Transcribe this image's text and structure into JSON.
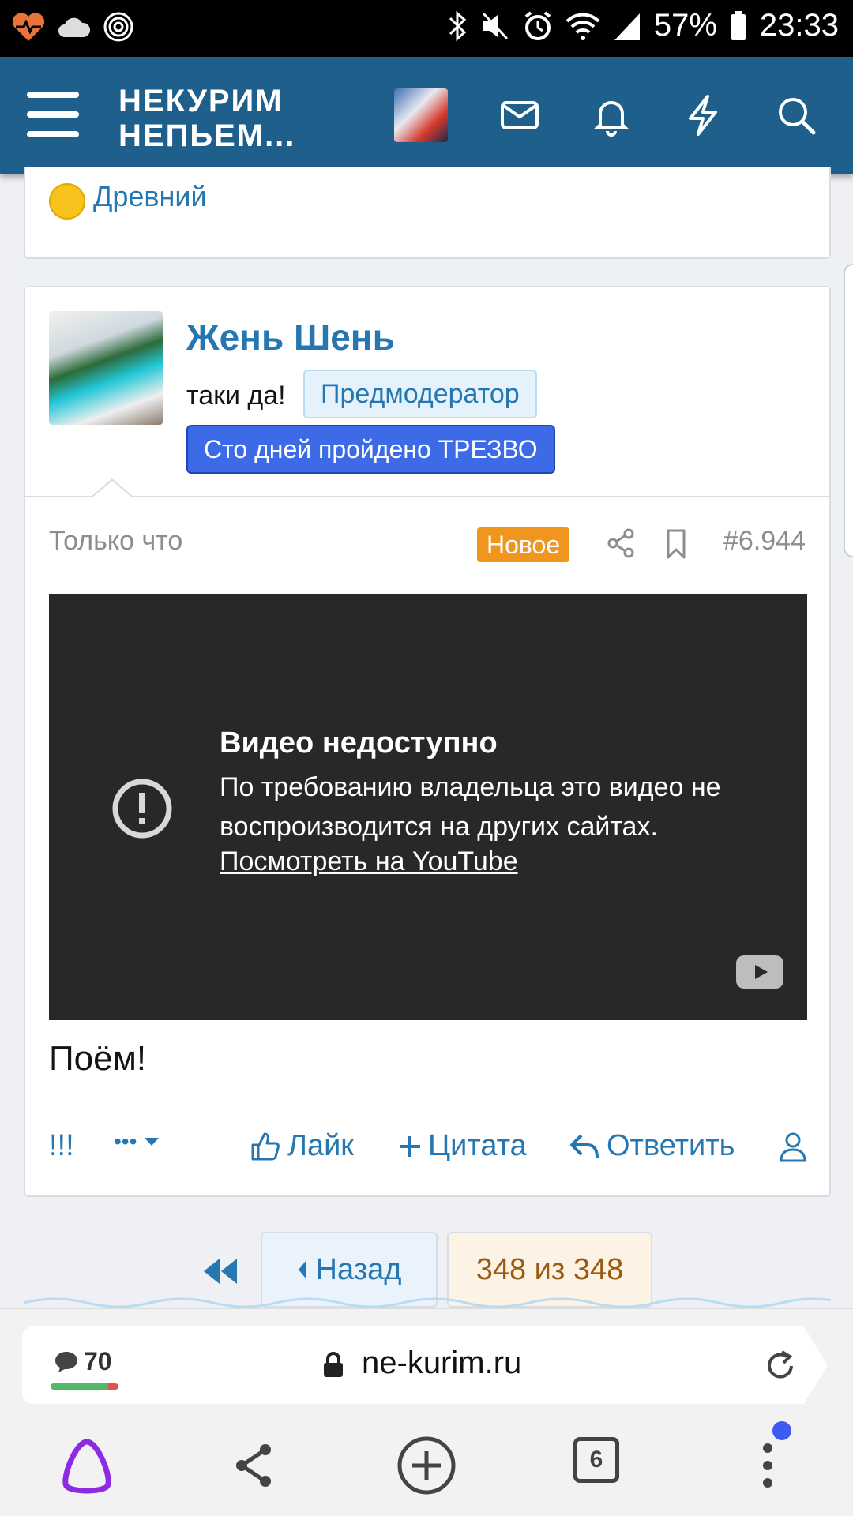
{
  "status_bar": {
    "battery_percent": "57%",
    "time": "23:33",
    "icons": [
      "heart-pulse-icon",
      "cloud-icon",
      "fingerprint-icon",
      "bluetooth-icon",
      "mute-icon",
      "alarm-icon",
      "wifi-icon",
      "signal-icon",
      "battery-icon"
    ]
  },
  "header": {
    "logo_line1": "НЕКУРИМ",
    "logo_line2": "НЕПЬЕМ...",
    "icons": [
      "menu-icon",
      "avatar",
      "mail-icon",
      "bell-icon",
      "lightning-icon",
      "search-icon"
    ],
    "bg_color": "#1f5f8b"
  },
  "prev_post": {
    "rank": "Древний"
  },
  "post": {
    "username": "Жень Шень",
    "user_title": "таки да!",
    "banner_mod": "Предмодератор",
    "banner_sober": "Сто дней пройдено ТРЕЗВО",
    "time": "Только что",
    "badge_new": "Новое",
    "post_number": "#6.944",
    "video": {
      "title": "Видео недоступно",
      "message": "По требованию владельца это видео не воспроизводится на других сайтах.",
      "link": "Посмотреть на YouTube"
    },
    "text": "Поём!",
    "actions": {
      "report": "!!!",
      "more": "•••",
      "like": "Лайк",
      "quote": "Цитата",
      "reply": "Ответить"
    }
  },
  "pagination": {
    "back": "Назад",
    "count": "348 из 348"
  },
  "browser": {
    "comments_count": "70",
    "url": "ne-kurim.ru",
    "tabs_count": "6"
  },
  "colors": {
    "link_blue": "#2577b1",
    "badge_orange": "#f0961e",
    "banner_blue": "#3d6be8"
  }
}
